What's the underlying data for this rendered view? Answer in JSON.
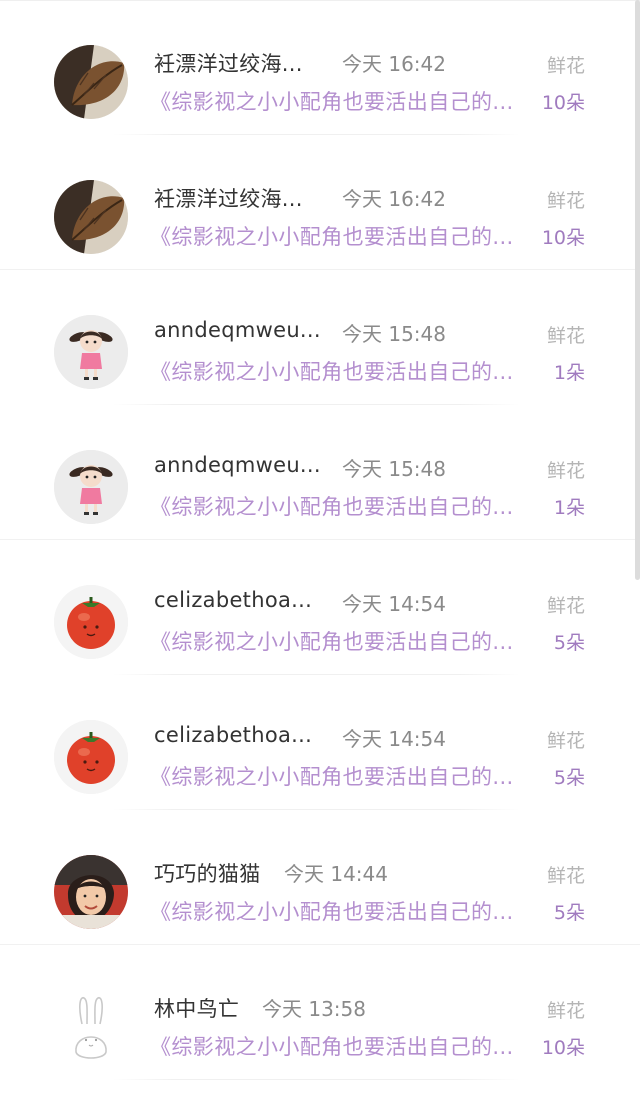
{
  "rows": [
    {
      "name": "衽漂洋过绞海...",
      "time": "今天 16:42",
      "type": "鲜花",
      "book": "《综影视之小小配角也要活出自己的...",
      "count": "10朵",
      "avatar": "leaf-avatar"
    },
    {
      "name": "衽漂洋过绞海...",
      "time": "今天 16:42",
      "type": "鲜花",
      "book": "《综影视之小小配角也要活出自己的...",
      "count": "10朵",
      "avatar": "leaf-avatar"
    },
    {
      "name": "anndeqmweu...",
      "time": "今天 15:48",
      "type": "鲜花",
      "book": "《综影视之小小配角也要活出自己的...",
      "count": "1朵",
      "avatar": "girl-avatar"
    },
    {
      "name": "anndeqmweu...",
      "time": "今天 15:48",
      "type": "鲜花",
      "book": "《综影视之小小配角也要活出自己的...",
      "count": "1朵",
      "avatar": "girl-avatar"
    },
    {
      "name": "celizabethoa...",
      "time": "今天 14:54",
      "type": "鲜花",
      "book": "《综影视之小小配角也要活出自己的...",
      "count": "5朵",
      "avatar": "tomato-avatar"
    },
    {
      "name": "celizabethoa...",
      "time": "今天 14:54",
      "type": "鲜花",
      "book": "《综影视之小小配角也要活出自己的...",
      "count": "5朵",
      "avatar": "tomato-avatar"
    },
    {
      "name": "巧巧的猫猫",
      "time": "今天 14:44",
      "type": "鲜花",
      "book": "《综影视之小小配角也要活出自己的...",
      "count": "5朵",
      "avatar": "photo-avatar"
    },
    {
      "name": "林中鸟亡",
      "time": "今天 13:58",
      "type": "鲜花",
      "book": "《综影视之小小配角也要活出自己的...",
      "count": "10朵",
      "avatar": "rabbit-avatar"
    }
  ],
  "colors": {
    "name": "#333333",
    "time": "#8a8a8a",
    "type": "#b5b5b5",
    "book": "#b48fcf",
    "count": "#a07bbf"
  }
}
